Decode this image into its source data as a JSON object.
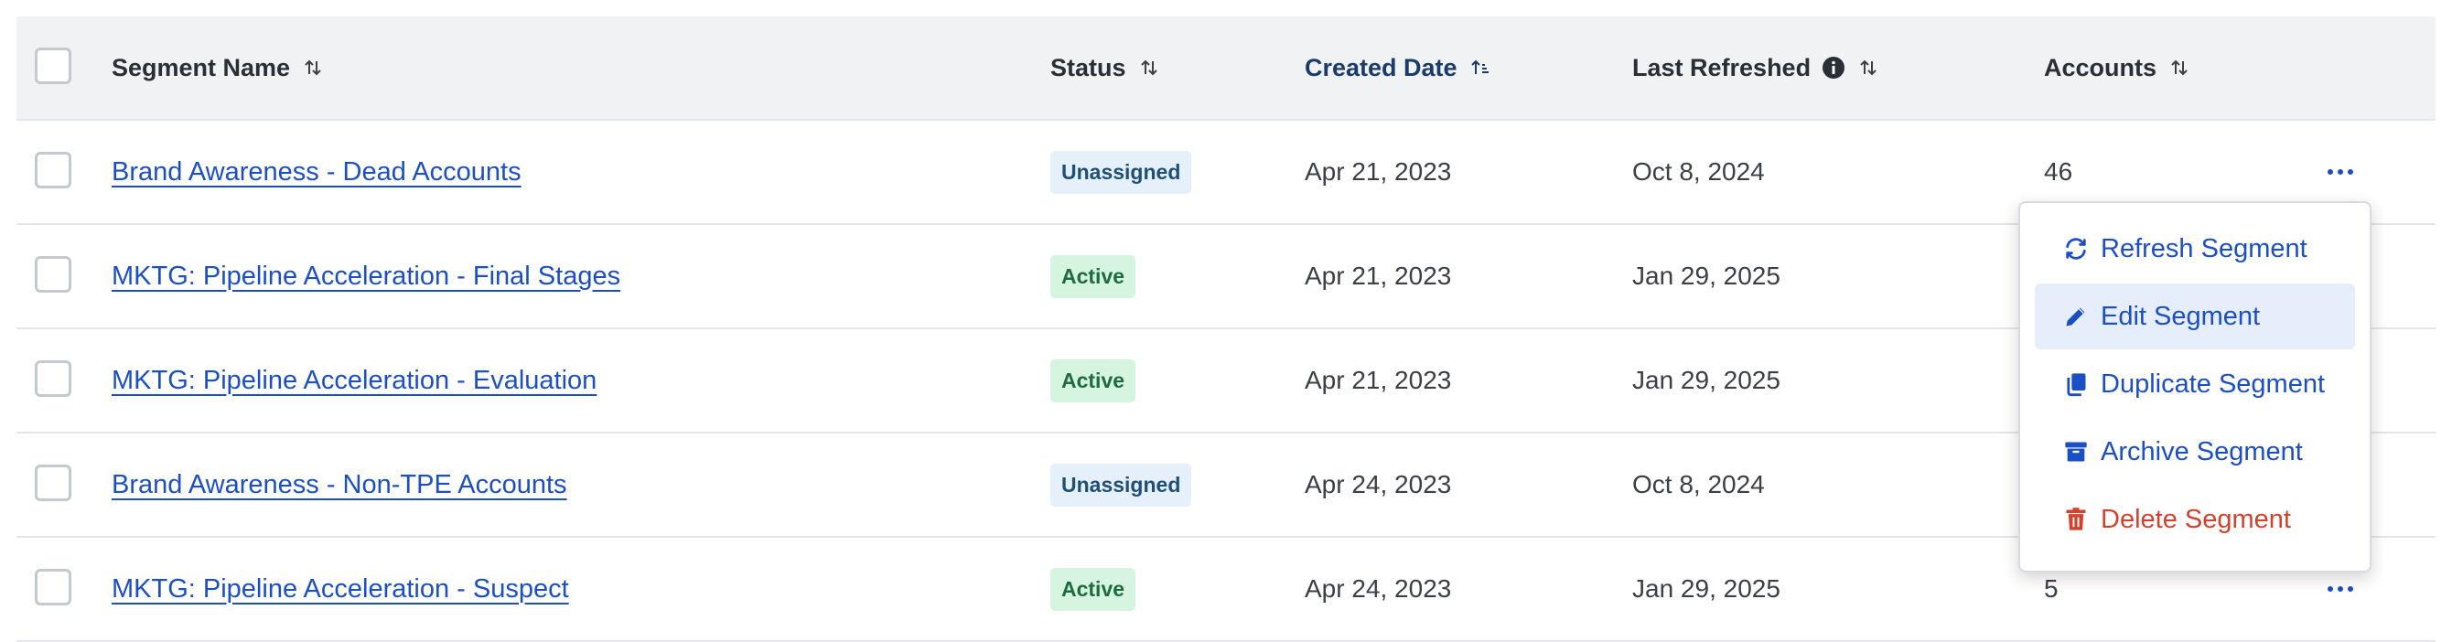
{
  "table": {
    "headers": {
      "name": "Segment Name",
      "status": "Status",
      "created": "Created Date",
      "refreshed": "Last Refreshed",
      "accounts": "Accounts"
    },
    "rows": [
      {
        "name": "Brand Awareness - Dead Accounts",
        "status": "Unassigned",
        "created": "Apr 21, 2023",
        "refreshed": "Oct 8, 2024",
        "accounts": "46"
      },
      {
        "name": "MKTG: Pipeline Acceleration - Final Stages",
        "status": "Active",
        "created": "Apr 21, 2023",
        "refreshed": "Jan 29, 2025",
        "accounts": ""
      },
      {
        "name": "MKTG: Pipeline Acceleration - Evaluation",
        "status": "Active",
        "created": "Apr 21, 2023",
        "refreshed": "Jan 29, 2025",
        "accounts": ""
      },
      {
        "name": "Brand Awareness - Non-TPE Accounts",
        "status": "Unassigned",
        "created": "Apr 24, 2023",
        "refreshed": "Oct 8, 2024",
        "accounts": ""
      },
      {
        "name": "MKTG: Pipeline Acceleration - Suspect",
        "status": "Active",
        "created": "Apr 24, 2023",
        "refreshed": "Jan 29, 2025",
        "accounts": "5"
      }
    ]
  },
  "menu": {
    "items": [
      {
        "label": "Refresh Segment",
        "icon": "refresh-icon"
      },
      {
        "label": "Edit Segment",
        "icon": "pencil-icon"
      },
      {
        "label": "Duplicate Segment",
        "icon": "duplicate-icon"
      },
      {
        "label": "Archive Segment",
        "icon": "archive-icon"
      },
      {
        "label": "Delete Segment",
        "icon": "trash-icon"
      }
    ]
  },
  "colors": {
    "link": "#1d4fc4",
    "danger": "#d0432f",
    "header_bg": "#f1f2f4",
    "active_badge_bg": "#d5f5e1",
    "unassigned_badge_bg": "#e5f0fa"
  }
}
